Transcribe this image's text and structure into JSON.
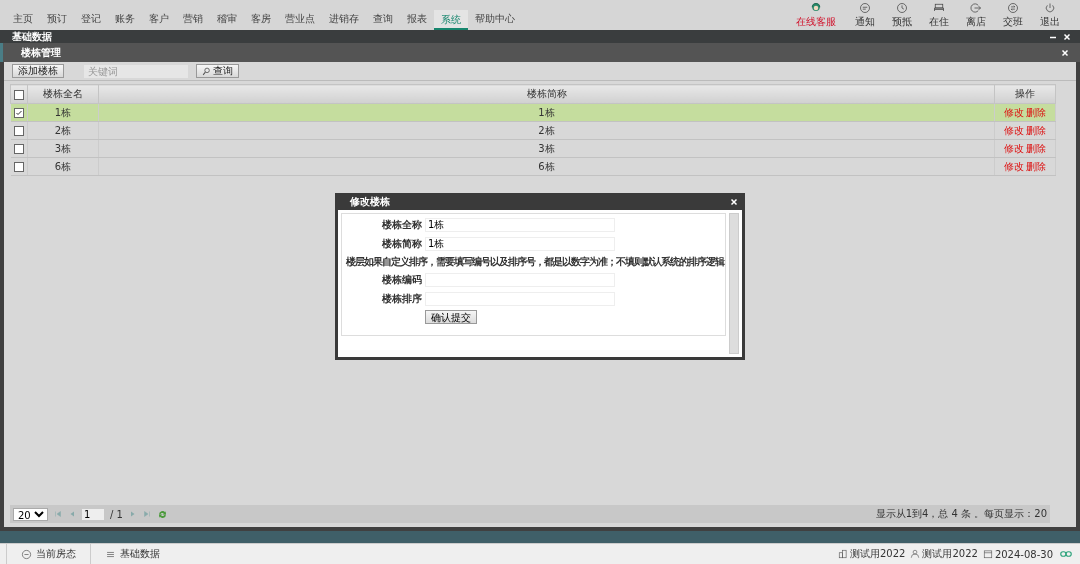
{
  "nav": {
    "items": [
      {
        "label": "主页",
        "selected": false
      },
      {
        "label": "预订",
        "selected": false
      },
      {
        "label": "登记",
        "selected": false
      },
      {
        "label": "账务",
        "selected": false
      },
      {
        "label": "客户",
        "selected": false
      },
      {
        "label": "营销",
        "selected": false
      },
      {
        "label": "稽审",
        "selected": false
      },
      {
        "label": "客房",
        "selected": false
      },
      {
        "label": "营业点",
        "selected": false
      },
      {
        "label": "进销存",
        "selected": false
      },
      {
        "label": "查询",
        "selected": false
      },
      {
        "label": "报表",
        "selected": false
      },
      {
        "label": "系统",
        "selected": true
      },
      {
        "label": "帮助中心",
        "selected": false
      }
    ],
    "tools": [
      {
        "label": "在线客服",
        "kind": "service"
      },
      {
        "label": "通知",
        "kind": "notice"
      },
      {
        "label": "预抵",
        "kind": "clock"
      },
      {
        "label": "在住",
        "kind": "bed"
      },
      {
        "label": "离店",
        "kind": "exit"
      },
      {
        "label": "交班",
        "kind": "shift"
      },
      {
        "label": "退出",
        "kind": "power"
      }
    ]
  },
  "panel": {
    "title": "基础数据",
    "subtitle": "楼栋管理"
  },
  "toolbar": {
    "add_button": "添加楼栋",
    "search": {
      "placeholder": "关键词"
    },
    "query_button": "查询"
  },
  "table": {
    "all_checked": false,
    "columns": [
      "楼栋全名",
      "楼栋简称",
      "操作"
    ],
    "rows": [
      {
        "full": "1栋",
        "short": "1栋",
        "selected": true,
        "checked": true,
        "actions": [
          "修改",
          "删除"
        ]
      },
      {
        "full": "2栋",
        "short": "2栋",
        "selected": false,
        "checked": false,
        "actions": [
          "修改",
          "删除"
        ]
      },
      {
        "full": "3栋",
        "short": "3栋",
        "selected": false,
        "checked": false,
        "actions": [
          "修改",
          "删除"
        ]
      },
      {
        "full": "6栋",
        "short": "6栋",
        "selected": false,
        "checked": false,
        "actions": [
          "修改",
          "删除"
        ]
      }
    ]
  },
  "pager": {
    "page_size": "20",
    "page": "1",
    "total_pages": "/ 1",
    "summary": "显示从1到4，总 4 条 。每页显示：20"
  },
  "dialog": {
    "title": "修改楼栋",
    "fields": [
      {
        "label": "楼栋全称",
        "value": "1栋"
      },
      {
        "label": "楼栋简称",
        "value": "1栋"
      },
      {
        "label": "楼栋编码"
      },
      {
        "label": "楼栋排序"
      }
    ],
    "note": "楼层如果自定义排序，需要填写编号以及排序号，都是以数字为准；不填则默认系统的排序逻辑",
    "submit": "确认提交"
  },
  "taskbar": {
    "tabs": [
      "当前房态",
      "基础数据"
    ],
    "hotel": "测试用2022",
    "user": "测试用2022",
    "date": "2024-08-30"
  }
}
